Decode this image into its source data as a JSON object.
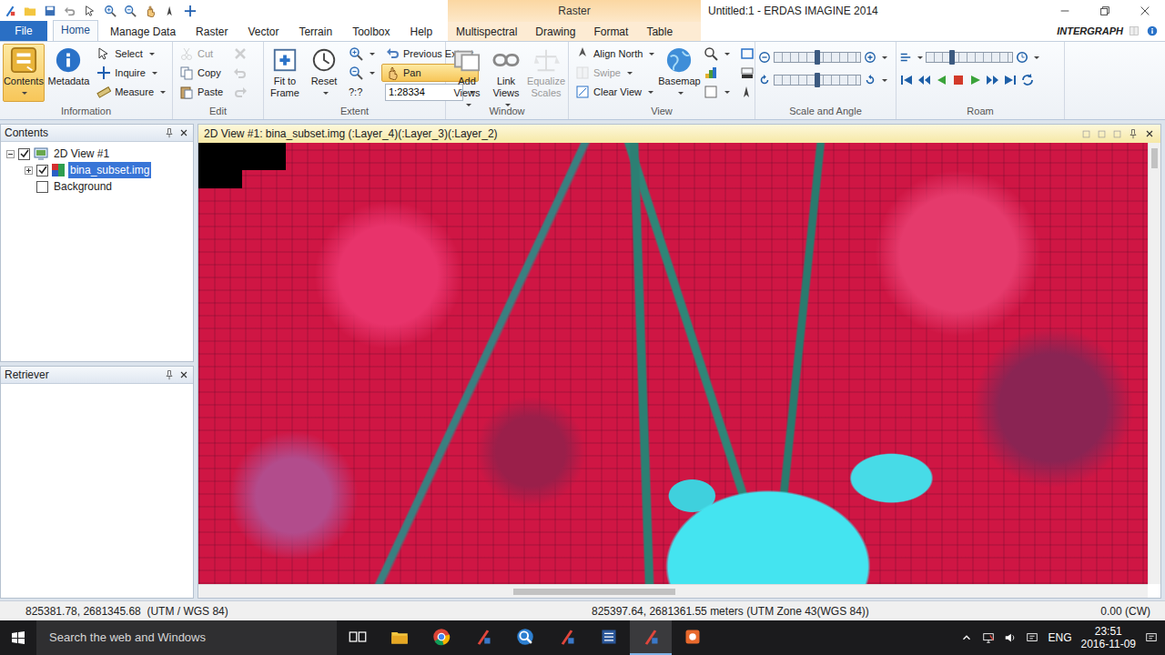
{
  "window": {
    "title": "Untitled:1 - ERDAS IMAGINE 2014",
    "brand": "INTERGRAPH"
  },
  "file_menu": {
    "label": "File"
  },
  "tabs": [
    {
      "label": "Home",
      "selected": true
    },
    {
      "label": "Manage Data",
      "selected": false
    },
    {
      "label": "Raster",
      "selected": false
    },
    {
      "label": "Vector",
      "selected": false
    },
    {
      "label": "Terrain",
      "selected": false
    },
    {
      "label": "Toolbox",
      "selected": false
    },
    {
      "label": "Help",
      "selected": false
    }
  ],
  "context_group": {
    "label": "Raster",
    "tabs": [
      {
        "label": "Multispectral",
        "selected": false
      },
      {
        "label": "Drawing",
        "selected": false
      },
      {
        "label": "Format",
        "selected": false
      },
      {
        "label": "Table",
        "selected": false
      }
    ]
  },
  "ribbon": [
    {
      "label": "Information",
      "items": [
        {
          "kind": "large",
          "label": "Contents",
          "selected": true,
          "disabled": false,
          "menu": true
        },
        {
          "kind": "large",
          "label": "Metadata",
          "selected": false,
          "disabled": false,
          "menu": false
        },
        {
          "kind": "stack",
          "rows": [
            {
              "label": "Select",
              "selected": false,
              "disabled": false,
              "menu": true
            },
            {
              "label": "Inquire",
              "selected": false,
              "disabled": false,
              "menu": true
            },
            {
              "label": "Measure",
              "selected": false,
              "disabled": false,
              "menu": true
            }
          ]
        }
      ]
    },
    {
      "label": "Edit",
      "items": [
        {
          "kind": "stack",
          "rows": [
            {
              "label": "Cut",
              "selected": false,
              "disabled": true,
              "menu": false
            },
            {
              "label": "Copy",
              "selected": false,
              "disabled": false,
              "menu": false
            },
            {
              "label": "Paste",
              "selected": false,
              "disabled": false,
              "menu": false
            }
          ]
        },
        {
          "kind": "stack",
          "rows": [
            {
              "selected": false,
              "disabled": true,
              "menu": false
            },
            {
              "selected": false,
              "disabled": true,
              "menu": false
            },
            {
              "selected": false,
              "disabled": true,
              "menu": false
            }
          ]
        }
      ]
    },
    {
      "label": "Extent",
      "items": [
        {
          "kind": "large",
          "label": "Fit to Frame",
          "selected": false,
          "disabled": false,
          "menu": false
        },
        {
          "kind": "large",
          "label": "Reset",
          "selected": false,
          "disabled": false,
          "menu": true
        },
        {
          "kind": "stack",
          "rows": [
            {
              "selected": false,
              "disabled": false,
              "menu": true
            },
            {
              "selected": false,
              "disabled": false,
              "menu": true
            },
            {
              "label": "?:?",
              "selected": false,
              "disabled": false,
              "menu": false
            }
          ]
        },
        {
          "kind": "stack",
          "rows": [
            {
              "label": "Previous Extent",
              "selected": false,
              "disabled": false,
              "menu": false
            },
            {
              "label": "Pan",
              "selected": true,
              "disabled": false,
              "menu": false
            },
            {
              "kind": "field",
              "value": "1:28334",
              "menu": true
            }
          ]
        }
      ]
    },
    {
      "label": "Window",
      "items": [
        {
          "kind": "large",
          "label": "Add Views",
          "selected": false,
          "disabled": false,
          "menu": true
        },
        {
          "kind": "large",
          "label": "Link Views",
          "selected": false,
          "disabled": false,
          "menu": true
        },
        {
          "kind": "large",
          "label": "Equalize Scales",
          "selected": false,
          "disabled": true,
          "menu": false
        }
      ]
    },
    {
      "label": "View",
      "items": [
        {
          "kind": "stack",
          "rows": [
            {
              "label": "Align North",
              "selected": false,
              "disabled": false,
              "menu": true
            },
            {
              "label": "Swipe",
              "selected": false,
              "disabled": true,
              "menu": true
            },
            {
              "label": "Clear View",
              "selected": false,
              "disabled": false,
              "menu": true
            }
          ]
        },
        {
          "kind": "large",
          "label": "Basemap",
          "selected": false,
          "disabled": false,
          "menu": true
        },
        {
          "kind": "stack",
          "rows": [
            {
              "selected": false,
              "disabled": false,
              "menu": true
            },
            {
              "selected": false,
              "disabled": false,
              "menu": false
            },
            {
              "selected": false,
              "disabled": false,
              "menu": true
            }
          ]
        },
        {
          "kind": "stack",
          "rows": [
            {
              "selected": false,
              "disabled": false,
              "menu": false
            },
            {
              "selected": false,
              "disabled": false,
              "menu": false
            },
            {
              "selected": false,
              "disabled": false,
              "menu": false
            }
          ]
        }
      ]
    },
    {
      "label": "Scale and Angle",
      "items": [
        {
          "kind": "sliders",
          "rows": [
            {
              "level": 0.5
            },
            {
              "level": 0.5
            }
          ]
        }
      ]
    },
    {
      "label": "Roam",
      "items": [
        {
          "kind": "roam",
          "level": 0.3,
          "buttons": [
            {
              "disabled": false
            },
            {
              "disabled": false
            },
            {
              "disabled": false
            },
            {
              "disabled": false
            },
            {
              "disabled": false
            },
            {
              "disabled": false
            },
            {
              "disabled": false
            },
            {
              "disabled": false
            }
          ]
        }
      ]
    }
  ],
  "contents": {
    "title": "Contents",
    "tree": [
      {
        "label": "2D View #1",
        "kind": "view",
        "checked": true,
        "expanded": true,
        "selected": false,
        "children": [
          {
            "label": "bina_subset.img",
            "kind": "raster",
            "checked": true,
            "expanded": false,
            "selected": true
          },
          {
            "label": "Background",
            "kind": "background",
            "checked": false,
            "selected": false
          }
        ]
      }
    ]
  },
  "retriever": {
    "title": "Retriever"
  },
  "view": {
    "title": "2D View #1: bina_subset.img (:Layer_4)(:Layer_3)(:Layer_2)",
    "hscroll": {
      "level": 0.4
    },
    "vscroll": {
      "level": 0
    }
  },
  "status_bar": [
    "825381.78, 2681345.68  (UTM / WGS 84)",
    "825397.64, 2681361.55 meters (UTM Zone 43(WGS 84))",
    "0.00 (CW)"
  ],
  "taskbar": {
    "search": {
      "placeholder": "Search the web and Windows"
    },
    "apps": [
      {
        "selected": false
      },
      {
        "selected": false
      },
      {
        "selected": false
      },
      {
        "selected": false
      },
      {
        "selected": false
      },
      {
        "selected": false
      },
      {
        "selected": false
      },
      {
        "selected": true
      },
      {
        "selected": false
      }
    ],
    "language": "ENG",
    "time": "23:51",
    "date": "2016-11-09"
  }
}
